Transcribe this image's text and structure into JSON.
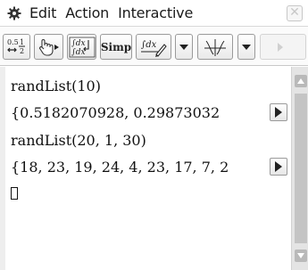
{
  "menu": {
    "items": [
      "Edit",
      "Action",
      "Interactive"
    ],
    "gear_icon": "gear-icon",
    "close_icon": "close-icon"
  },
  "toolbar": {
    "buttons": [
      {
        "name": "fraction-decimal-toggle",
        "icon": "fraction-decimal-icon",
        "label": "0.5 ↔ 1/2"
      },
      {
        "name": "hand-pointer-button",
        "icon": "hand-pointer-icon"
      },
      {
        "name": "integral-substitute-button",
        "icon": "integral-icon"
      },
      {
        "name": "simp-button",
        "label": "Simp"
      },
      {
        "name": "integral-pen-button",
        "icon": "integral-pen-icon"
      },
      {
        "name": "dropdown-1",
        "icon": "triangle-down-icon"
      },
      {
        "name": "graph-axes-button",
        "icon": "graph-axes-icon"
      },
      {
        "name": "dropdown-2",
        "icon": "triangle-down-icon"
      },
      {
        "name": "next-button",
        "icon": "triangle-right-icon",
        "disabled": true
      }
    ],
    "simp_label": "Simp"
  },
  "work": {
    "lines": [
      {
        "type": "input",
        "text": "randList(10)"
      },
      {
        "type": "output",
        "text": "{0.5182070928, 0.29873032"
      },
      {
        "type": "input",
        "text": "randList(20, 1, 30)"
      },
      {
        "type": "output",
        "text": "{18, 23, 19, 24, 4, 23, 17, 7, 2"
      }
    ]
  },
  "colors": {
    "accent": "#9a9a9a",
    "scrollbar": "#c4c4c4"
  }
}
